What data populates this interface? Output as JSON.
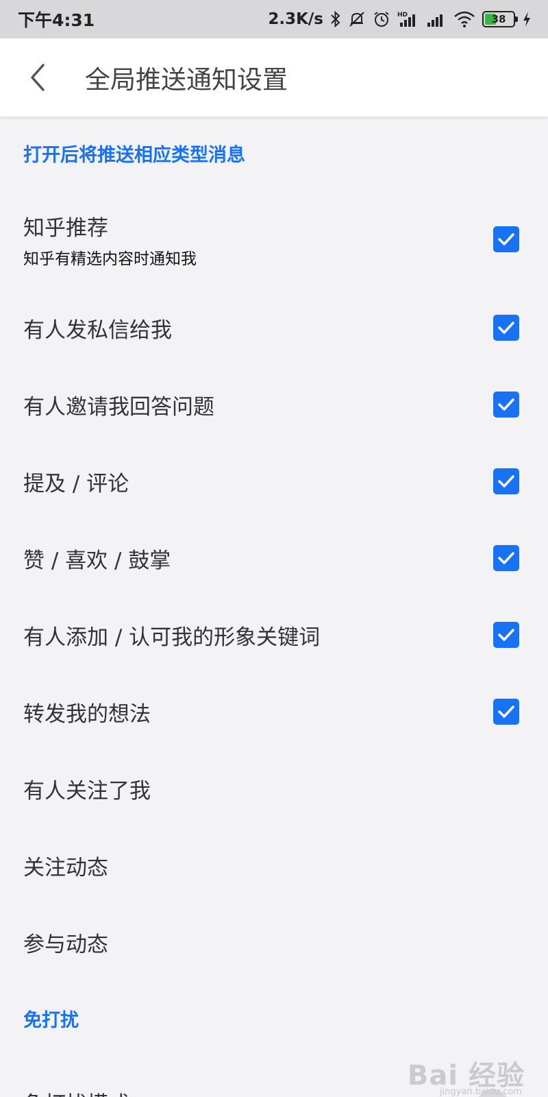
{
  "status_bar": {
    "time": "下午4:31",
    "net_speed": "2.3K/s",
    "battery": "38",
    "icons": [
      "bluetooth-icon",
      "mute-icon",
      "alarm-icon",
      "hd-signal-icon",
      "signal-icon",
      "wifi-icon",
      "battery-icon",
      "charging-icon"
    ]
  },
  "header": {
    "title": "全局推送通知设置",
    "back_icon": "chevron-left-icon"
  },
  "sections": {
    "push_types": {
      "header": "打开后将推送相应类型消息",
      "items": [
        {
          "title": "知乎推荐",
          "desc": "知乎有精选内容时通知我",
          "checked": true
        },
        {
          "title": "有人发私信给我",
          "checked": true
        },
        {
          "title": "有人邀请我回答问题",
          "checked": true
        },
        {
          "title": "提及 / 评论",
          "checked": true
        },
        {
          "title": "赞 / 喜欢 / 鼓掌",
          "checked": true
        },
        {
          "title": "有人添加 / 认可我的形象关键词",
          "checked": true
        },
        {
          "title": "转发我的想法",
          "checked": true
        },
        {
          "title": "有人关注了我",
          "checked": false
        },
        {
          "title": "关注动态",
          "checked": false
        },
        {
          "title": "参与动态",
          "checked": false
        }
      ]
    },
    "dnd": {
      "header": "免打扰",
      "items": [
        {
          "title": "免打扰模式"
        }
      ]
    }
  },
  "colors": {
    "accent": "#1772f6",
    "background": "#f3f3f5",
    "appbar": "#ffffff",
    "statusbar": "#d8d8da"
  },
  "watermark": {
    "text": "Bai 经验",
    "sub": "jingyan.baidu.com"
  }
}
